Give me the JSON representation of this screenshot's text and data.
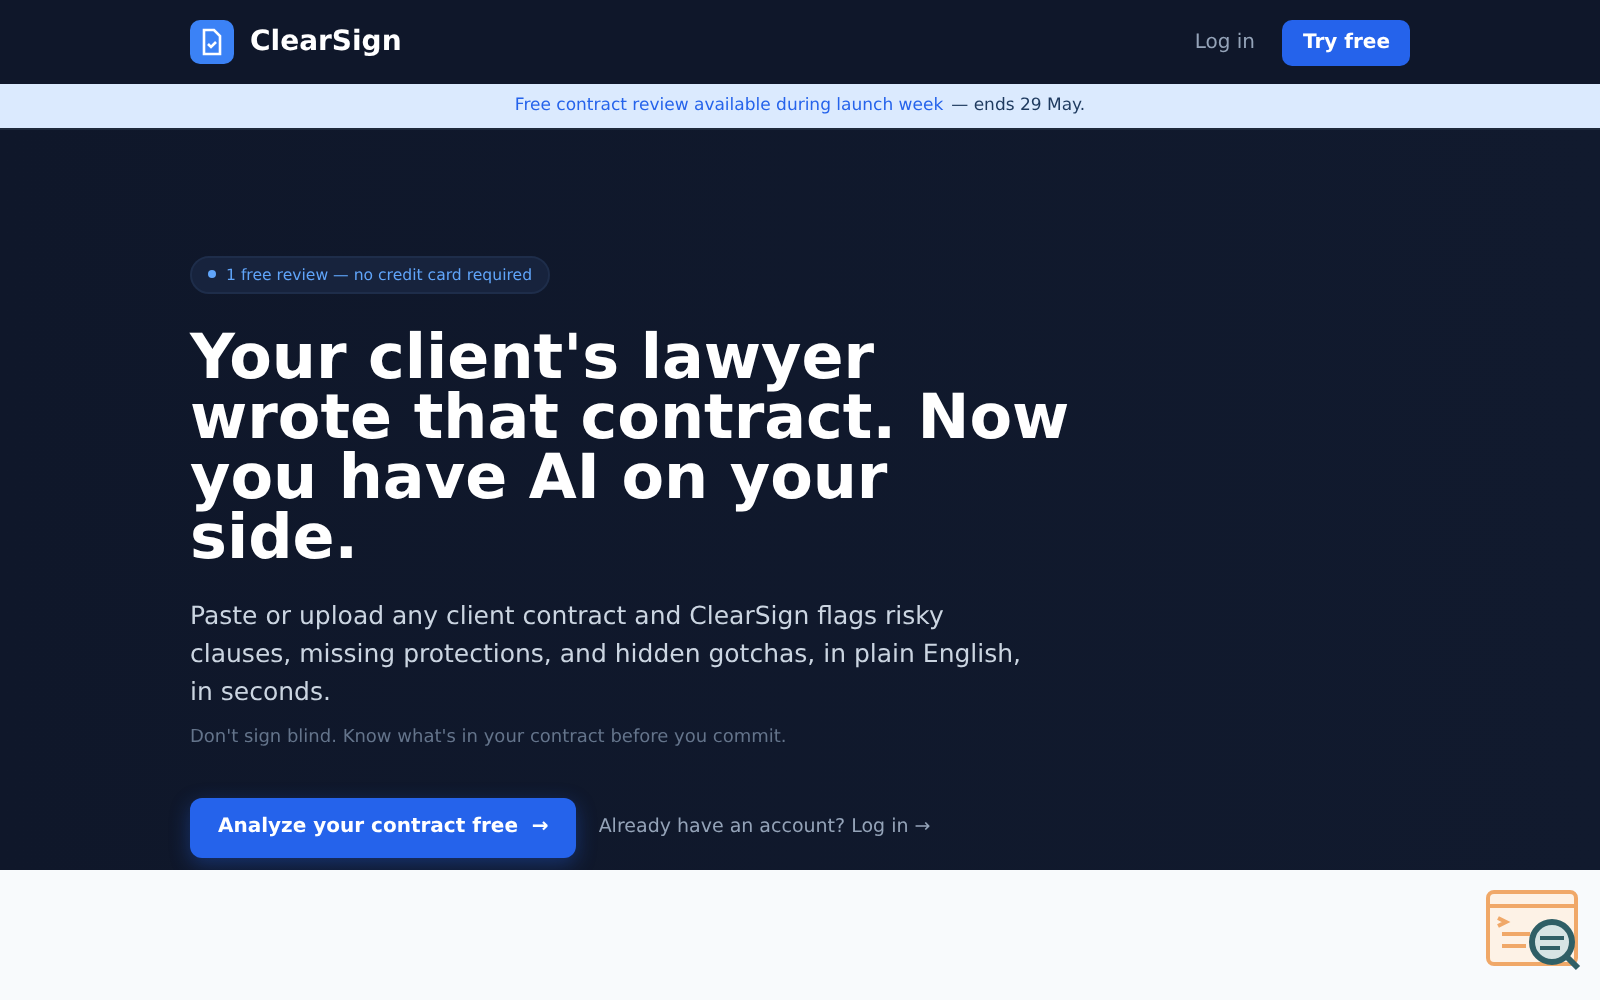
{
  "nav": {
    "brand": "ClearSign",
    "login": "Log in",
    "cta": "Try free"
  },
  "banner": {
    "message": "Free contract review available during launch week",
    "deadline": "— ends 29 May."
  },
  "hero": {
    "pill": "1 free review — no credit card required",
    "headline": "Your client's lawyer wrote that contract. Now you have AI on your side.",
    "lead": "Paste or upload any client contract and ClearSign flags risky clauses, missing protections, and hidden gotchas, in plain English, in seconds.",
    "note": "Don't sign blind. Know what's in your contract before you commit.",
    "primary": "Analyze your contract free",
    "primary_arrow": "→",
    "secondary": "Already have an account? Log in →"
  }
}
